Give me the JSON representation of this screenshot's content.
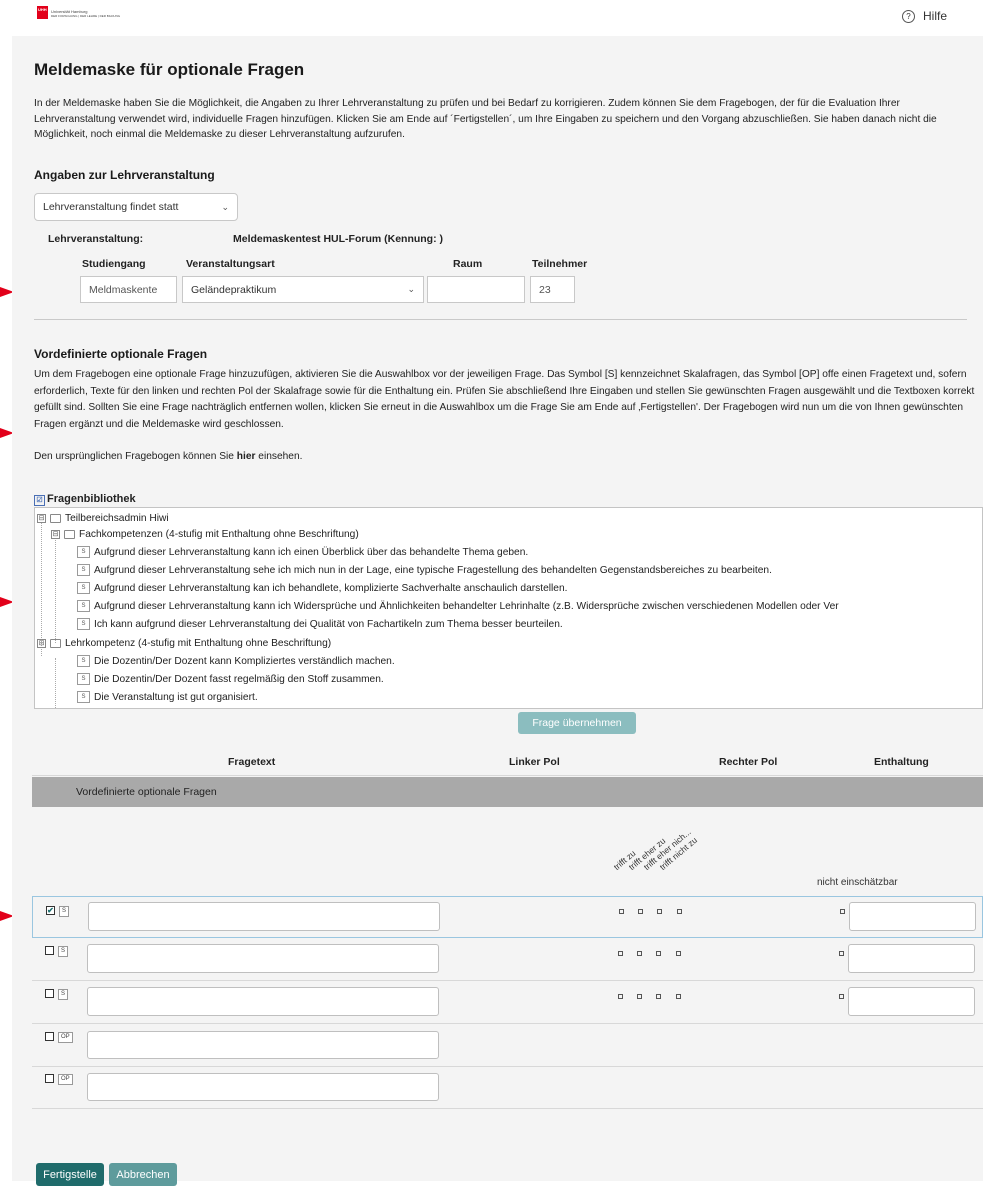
{
  "header": {
    "logo_text_line1": "Universität Hamburg",
    "logo_text_line2": "DER FORSCHUNG | DER LEHRE | DER BILDUNG",
    "logo_mark": "UHH",
    "help_label": "Hilfe",
    "help_icon": "?"
  },
  "page": {
    "title": "Meldemaske für optionale Fragen",
    "intro": "In der Meldemaske haben Sie die Möglichkeit, die Angaben zu Ihrer Lehrveranstaltung zu prüfen und bei Bedarf zu korrigieren. Zudem können Sie dem Fragebogen, der für die Evaluation Ihrer Lehrveranstaltung verwendet wird, individuelle Fragen hinzufügen. Klicken Sie am Ende auf ´Fertigstellen´, um Ihre Eingaben zu speichern und den Vorgang abzuschließen. Sie haben danach nicht die Möglichkeit, noch einmal die Meldemaske zu dieser Lehrveranstaltung aufzurufen."
  },
  "course": {
    "section_title": "Angaben zur Lehrveranstaltung",
    "status_select": "Lehrveranstaltung findet statt",
    "course_label": "Lehrveranstaltung:",
    "course_name": "Meldemaskentest HUL-Forum (Kennung: )",
    "col_program": "Studiengang",
    "col_type": "Veranstaltungsart",
    "col_room": "Raum",
    "col_participants": "Teilnehmer",
    "program_value": "Meldmaskente",
    "type_value": "Geländepraktikum",
    "room_value": "",
    "participants_value": "23"
  },
  "predefined": {
    "section_title": "Vordefinierte optionale Fragen",
    "description": "Um dem Fragebogen eine optionale Frage hinzuzufügen, aktivieren Sie die Auswahlbox vor der jeweiligen Frage. Das Symbol [S] kennzeichnet Skalafragen, das Symbol [OP] offe einen Fragetext und, sofern erforderlich, Texte für den linken und rechten Pol der Skalafrage sowie für die Enthaltung ein. Prüfen Sie abschließend Ihre Eingaben und stellen Sie gewünschten Fragen ausgewählt und die Textboxen korrekt gefüllt sind. Sollten Sie eine Frage nachträglich entfernen wollen, klicken Sie erneut in die Auswahlbox um die Frage Sie am Ende auf ‚Fertigstellen'. Der Fragebogen wird nun um die von Ihnen gewünschten Fragen ergänzt und die Meldemaske wird geschlossen.",
    "original_link_pre": "Den ursprünglichen Fragebogen können Sie ",
    "original_link_bold": "hier",
    "original_link_post": " einsehen."
  },
  "library": {
    "title": "Fragenbibliothek",
    "title_icon": "☑",
    "root": "Teilbereichsadmin Hiwi",
    "group1": "Fachkompetenzen (4-stufig mit Enthaltung ohne Beschriftung)",
    "group1_items": [
      "Aufgrund dieser Lehrveranstaltung kann ich einen Überblick über das behandelte Thema geben.",
      "Aufgrund dieser Lehrveranstaltung sehe ich mich nun in der Lage, eine typische Fragestellung des behandelten Gegenstandsbereiches zu bearbeiten.",
      "Aufgrund dieser Lehrveranstaltung kan ich behandlete, komplizierte Sachverhalte anschaulich darstellen.",
      "Aufgrund dieser Lehrveranstaltung kann ich Widersprüche und Ähnlichkeiten behandelter Lehrinhalte (z.B. Widersprüche zwischen verschiedenen Modellen oder Ver",
      "Ich kann aufgrund dieser Lehrveranstaltung dei Qualität von Fachartikeln zum Thema besser beurteilen."
    ],
    "group2": "Lehrkompetenz (4-stufig mit Enthaltung ohne Beschriftung)",
    "group2_items": [
      "Die Dozentin/Der Dozent kann Kompliziertes verständlich machen.",
      "Die Dozentin/Der Dozent fasst regelmäßig den Stoff zusammen.",
      "Die Veranstaltung ist gut organisiert."
    ],
    "item_tag": "S",
    "expand_symbol": "⊟"
  },
  "actions": {
    "accept_question": "Frage übernehmen",
    "finish": "Fertigstelle",
    "cancel": "Abbrechen"
  },
  "table": {
    "col_text": "Fragetext",
    "col_left": "Linker Pol",
    "col_right": "Rechter Pol",
    "col_abstain": "Enthaltung",
    "group_label": "Vordefinierte optionale Fragen",
    "scale_labels": [
      "trifft zu",
      "trifft eher zu",
      "trifft eher nich...",
      "trifft nicht zu"
    ],
    "abstain_label": "nicht einschätzbar",
    "rows": [
      {
        "tag": "S",
        "checked": true,
        "checkmark": "✔"
      },
      {
        "tag": "S",
        "checked": false
      },
      {
        "tag": "S",
        "checked": false
      },
      {
        "tag": "OP",
        "checked": false
      },
      {
        "tag": "OP",
        "checked": false
      }
    ]
  },
  "colors": {
    "accent_teal": "#1f6b6b",
    "accent_light": "#8bbdbf",
    "brand_red": "#e2001a",
    "group_gray": "#a9a9a9"
  }
}
